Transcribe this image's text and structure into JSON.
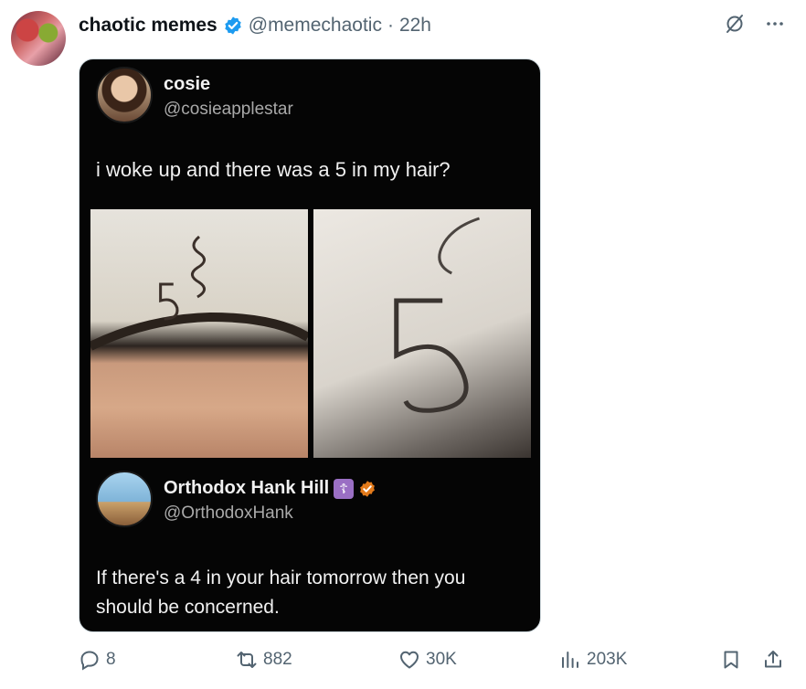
{
  "post": {
    "author_name": "chaotic memes",
    "handle": "@memechaotic",
    "separator": "·",
    "time": "22h"
  },
  "quoted": {
    "name": "cosie",
    "handle": "@cosieapplestar",
    "text": "i woke up and there was a 5 in my hair?"
  },
  "reply": {
    "name": "Orthodox Hank Hill",
    "badge_glyph": "☦",
    "handle": "@OrthodoxHank",
    "text": "If there's a 4 in your hair tomorrow then you should be concerned."
  },
  "actions": {
    "replies": "8",
    "reposts": "882",
    "likes": "30K",
    "views": "203K"
  },
  "colors": {
    "verified_blue": "#1d9bf0",
    "muted": "#536471",
    "orange_check": "#e27a1b"
  }
}
